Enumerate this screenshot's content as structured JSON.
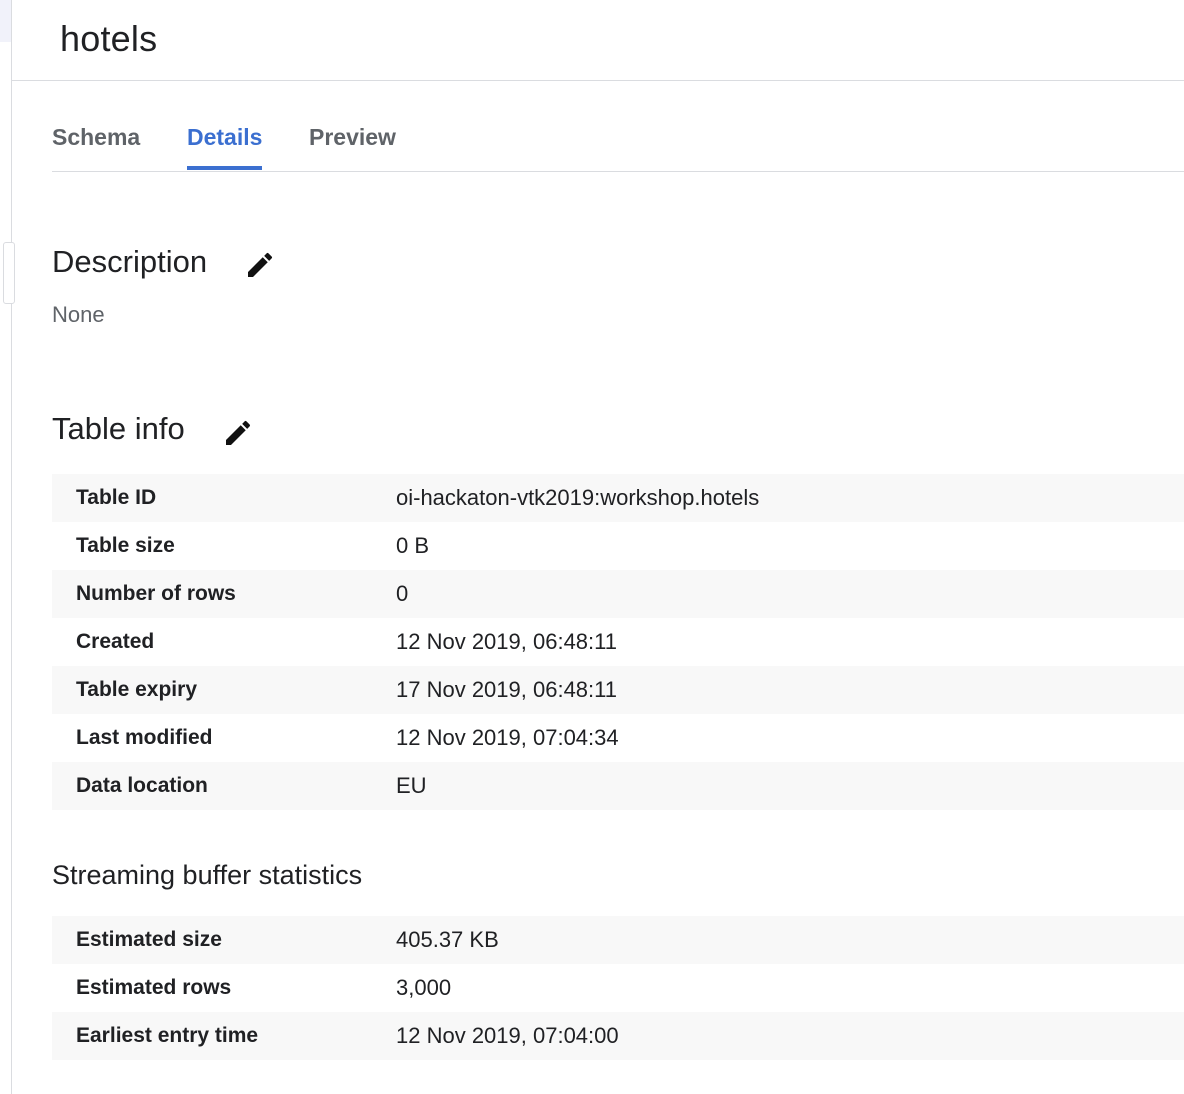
{
  "header": {
    "title": "hotels"
  },
  "tabs": [
    {
      "label": "Schema",
      "active": false
    },
    {
      "label": "Details",
      "active": true
    },
    {
      "label": "Preview",
      "active": false
    }
  ],
  "description": {
    "heading": "Description",
    "value": "None",
    "edit_icon": "pencil-icon"
  },
  "table_info": {
    "heading": "Table info",
    "edit_icon": "pencil-icon",
    "rows": [
      {
        "key": "Table ID",
        "value": "oi-hackaton-vtk2019:workshop.hotels"
      },
      {
        "key": "Table size",
        "value": "0 B"
      },
      {
        "key": "Number of rows",
        "value": "0"
      },
      {
        "key": "Created",
        "value": "12 Nov 2019, 06:48:11"
      },
      {
        "key": "Table expiry",
        "value": "17 Nov 2019, 06:48:11"
      },
      {
        "key": "Last modified",
        "value": "12 Nov 2019, 07:04:34"
      },
      {
        "key": "Data location",
        "value": "EU"
      }
    ]
  },
  "streaming_buffer": {
    "heading": "Streaming buffer statistics",
    "rows": [
      {
        "key": "Estimated size",
        "value": "405.37 KB"
      },
      {
        "key": "Estimated rows",
        "value": "3,000"
      },
      {
        "key": "Earliest entry time",
        "value": "12 Nov 2019, 07:04:00"
      }
    ]
  },
  "colors": {
    "accent": "#3b6fd0",
    "text": "#202124",
    "muted": "#5f6368",
    "row_shade": "#f8f8f8",
    "divider": "#dadce0"
  }
}
